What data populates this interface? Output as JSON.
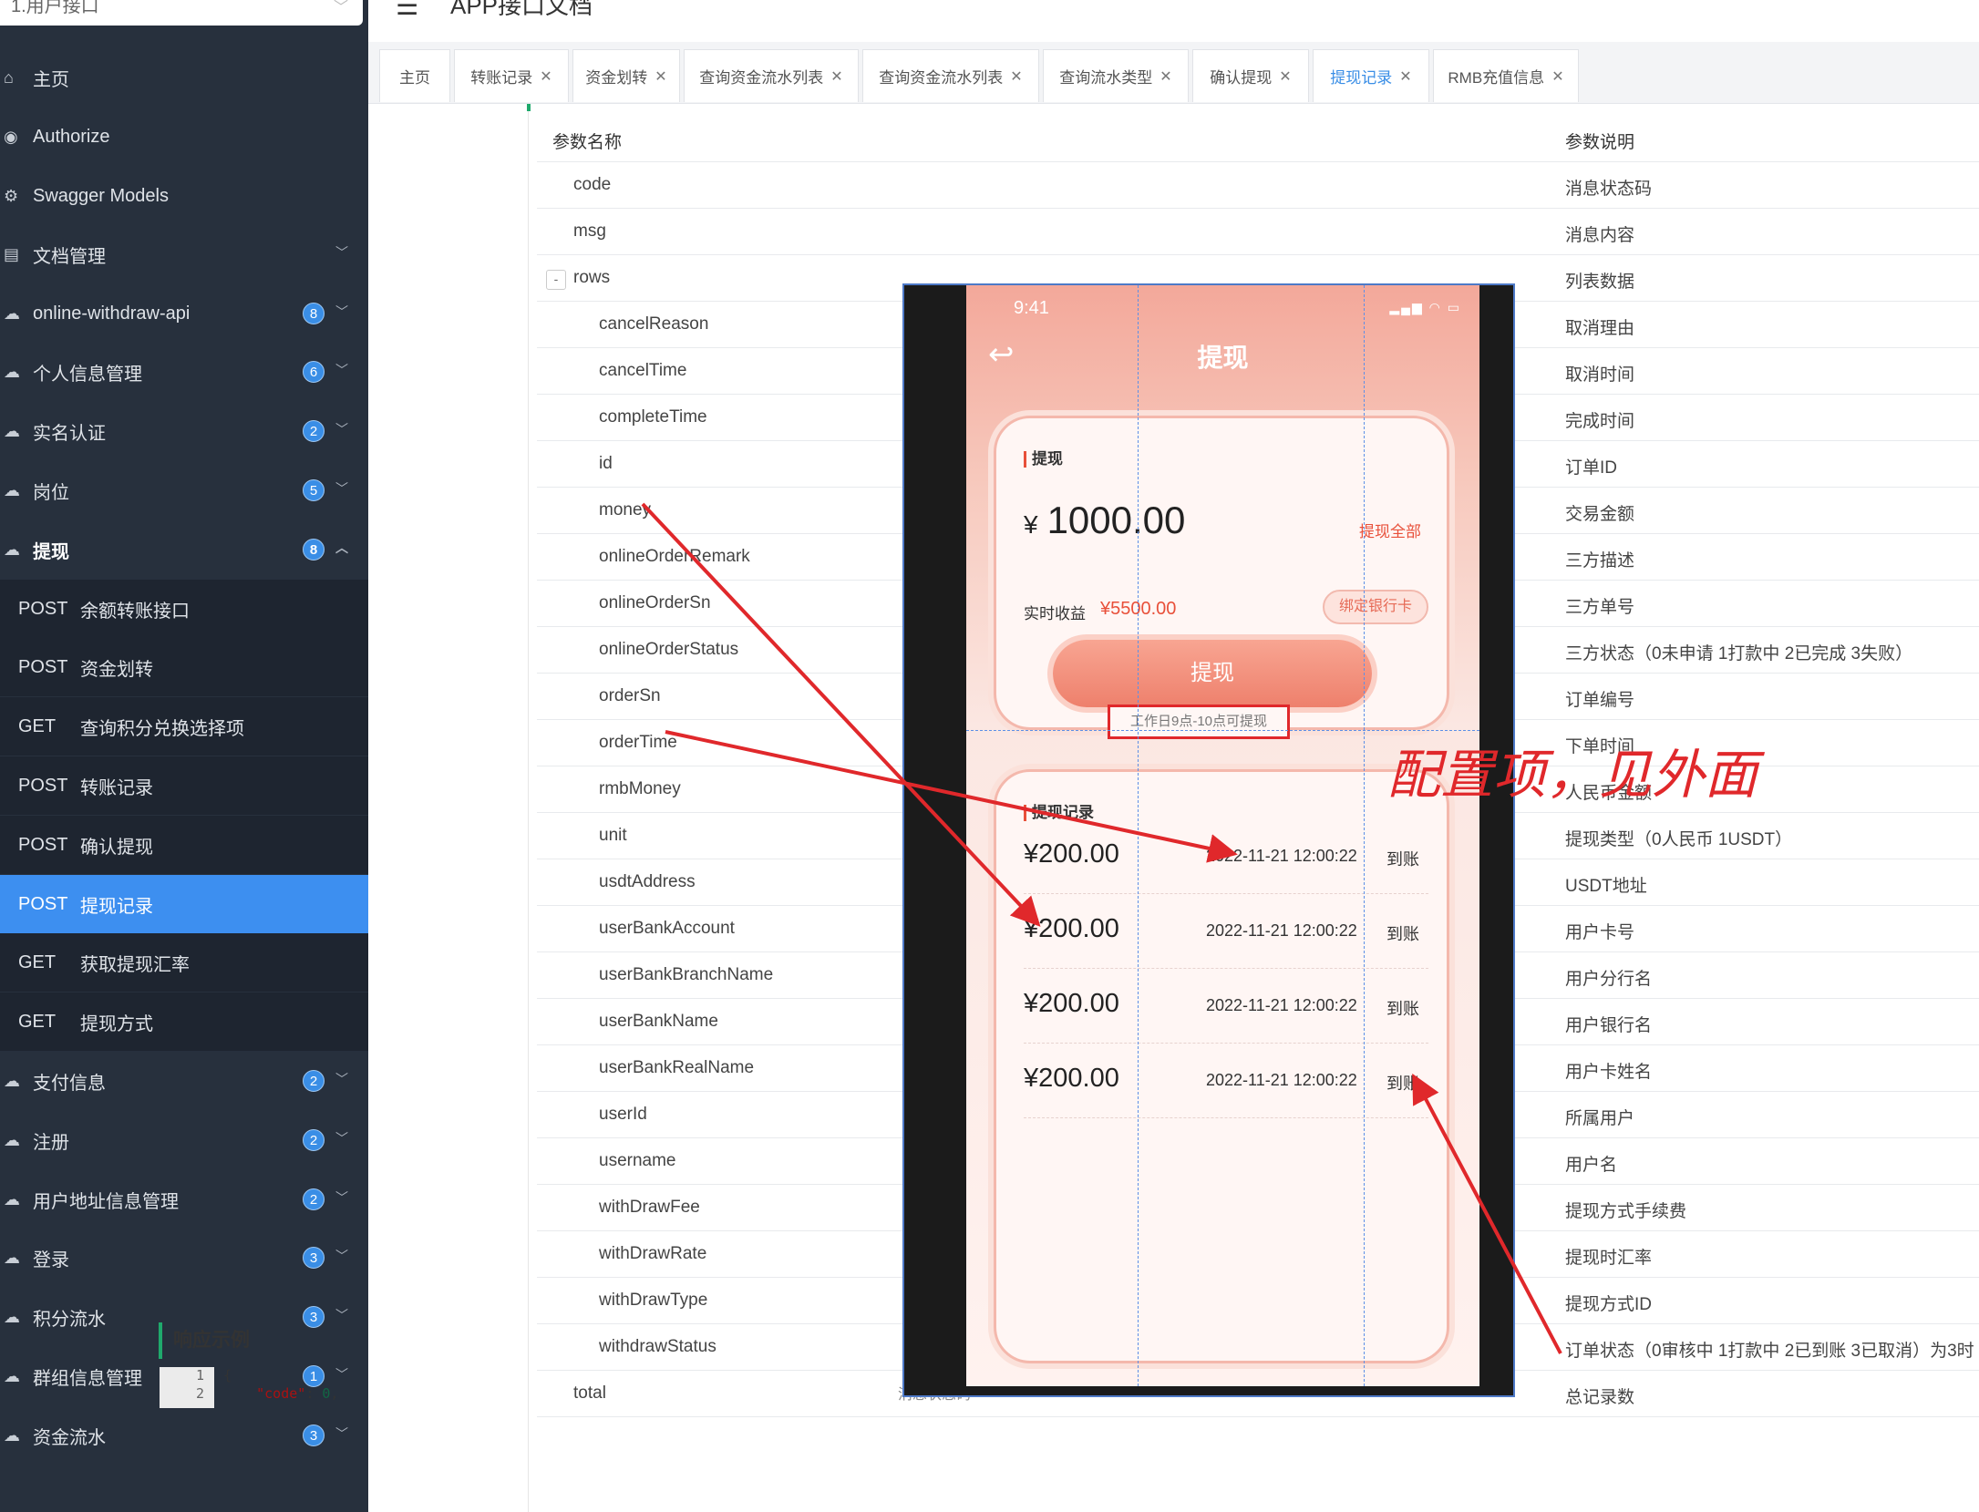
{
  "sidebar": {
    "group_select": "1.用户接口",
    "items": [
      {
        "label": "主页",
        "icon": "home-icon"
      },
      {
        "label": "Authorize",
        "icon": "lock-icon"
      },
      {
        "label": "Swagger Models",
        "icon": "gear-icon"
      },
      {
        "label": "文档管理",
        "icon": "document-icon"
      },
      {
        "label": "online-withdraw-api",
        "badge": "8",
        "icon": "cloud-icon"
      },
      {
        "label": "个人信息管理",
        "badge": "6",
        "icon": "cloud-icon"
      },
      {
        "label": "实名认证",
        "badge": "2",
        "icon": "cloud-icon"
      },
      {
        "label": "岗位",
        "badge": "5",
        "icon": "cloud-icon"
      },
      {
        "label": "提现",
        "badge": "8",
        "icon": "cloud-icon"
      },
      {
        "label": "支付信息",
        "badge": "2",
        "icon": "cloud-icon"
      },
      {
        "label": "注册",
        "badge": "2",
        "icon": "cloud-icon"
      },
      {
        "label": "用户地址信息管理",
        "badge": "2",
        "icon": "cloud-icon"
      },
      {
        "label": "登录",
        "badge": "3",
        "icon": "cloud-icon"
      },
      {
        "label": "积分流水",
        "badge": "3",
        "icon": "cloud-icon"
      },
      {
        "label": "群组信息管理",
        "badge": "1",
        "icon": "cloud-icon"
      },
      {
        "label": "资金流水",
        "badge": "3",
        "icon": "cloud-icon"
      }
    ],
    "sub_items": [
      {
        "method": "POST",
        "label": "余额转账接口"
      },
      {
        "method": "POST",
        "label": "资金划转"
      },
      {
        "method": "GET",
        "label": "查询积分兑换选择项"
      },
      {
        "method": "POST",
        "label": "转账记录"
      },
      {
        "method": "POST",
        "label": "确认提现"
      },
      {
        "method": "POST",
        "label": "提现记录"
      },
      {
        "method": "GET",
        "label": "获取提现汇率"
      },
      {
        "method": "GET",
        "label": "提现方式"
      }
    ]
  },
  "header": {
    "title": "APP接口文档"
  },
  "tabs": [
    {
      "label": "主页"
    },
    {
      "label": "转账记录"
    },
    {
      "label": "资金划转"
    },
    {
      "label": "查询资金流水列表"
    },
    {
      "label": "查询资金流水列表"
    },
    {
      "label": "查询流水类型"
    },
    {
      "label": "确认提现"
    },
    {
      "label": "提现记录"
    },
    {
      "label": "RMB充值信息"
    }
  ],
  "table": {
    "header": {
      "name": "参数名称",
      "desc": "参数说明"
    },
    "rows": [
      {
        "name": "code",
        "desc": "消息状态码"
      },
      {
        "name": "msg",
        "desc": "消息内容"
      },
      {
        "name": "rows",
        "desc": "列表数据",
        "toggle": "-"
      },
      {
        "name": "cancelReason",
        "desc": "取消理由"
      },
      {
        "name": "cancelTime",
        "desc": "取消时间"
      },
      {
        "name": "completeTime",
        "desc": "完成时间"
      },
      {
        "name": "id",
        "desc": "订单ID"
      },
      {
        "name": "money",
        "desc": "交易金额"
      },
      {
        "name": "onlineOrderRemark",
        "desc": "三方描述"
      },
      {
        "name": "onlineOrderSn",
        "desc": "三方单号"
      },
      {
        "name": "onlineOrderStatus",
        "desc": "三方状态（0未申请 1打款中 2已完成 3失败）"
      },
      {
        "name": "orderSn",
        "desc": "订单编号"
      },
      {
        "name": "orderTime",
        "desc": "下单时间"
      },
      {
        "name": "rmbMoney",
        "desc": "人民币金额"
      },
      {
        "name": "unit",
        "desc": "提现类型（0人民币 1USDT）"
      },
      {
        "name": "usdtAddress",
        "desc": "USDT地址"
      },
      {
        "name": "userBankAccount",
        "desc": "用户卡号"
      },
      {
        "name": "userBankBranchName",
        "desc": "用户分行名"
      },
      {
        "name": "userBankName",
        "desc": "用户银行名"
      },
      {
        "name": "userBankRealName",
        "desc": "用户卡姓名"
      },
      {
        "name": "userId",
        "desc": "所属用户"
      },
      {
        "name": "username",
        "desc": "用户名"
      },
      {
        "name": "withDrawFee",
        "desc": "提现方式手续费"
      },
      {
        "name": "withDrawRate",
        "desc": "提现时汇率"
      },
      {
        "name": "withDrawType",
        "desc": "提现方式ID"
      },
      {
        "name": "withdrawStatus",
        "desc": "订单状态（0审核中 1打款中 2已到账 3已取消）为3时"
      },
      {
        "name": "total",
        "desc": "总记录数"
      }
    ]
  },
  "response": {
    "title": "响应示例",
    "line_numbers": [
      "1",
      "2"
    ],
    "line1": "{",
    "line2_key": "\"code\"",
    "line2_val": "0",
    "desc": "消息状态码"
  },
  "phone": {
    "time": "9:41",
    "title": "提现",
    "card1_title": "提现",
    "currency": "¥",
    "amount": "1000.00",
    "withdraw_all": "提现全部",
    "income_label": "实时收益",
    "income_value": "¥5500.00",
    "bind_card": "绑定银行卡",
    "withdraw_button": "提现",
    "note": "工作日9点-10点可提现",
    "card2_title": "提现记录",
    "records": [
      {
        "amount": "¥200.00",
        "time": "2022-11-21 12:00:22",
        "status": "到账"
      },
      {
        "amount": "¥200.00",
        "time": "2022-11-21 12:00:22",
        "status": "到账"
      },
      {
        "amount": "¥200.00",
        "time": "2022-11-21 12:00:22",
        "status": "到账"
      },
      {
        "amount": "¥200.00",
        "time": "2022-11-21 12:00:22",
        "status": "到账"
      }
    ]
  },
  "annotation": {
    "text": "配置项，见外面",
    "color": "#e0282b"
  },
  "colors": {
    "sidebar_bg": "#27303d",
    "selected": "#3d8ff0",
    "accent_green": "#1fa96c",
    "phone_red": "#e8503a"
  }
}
